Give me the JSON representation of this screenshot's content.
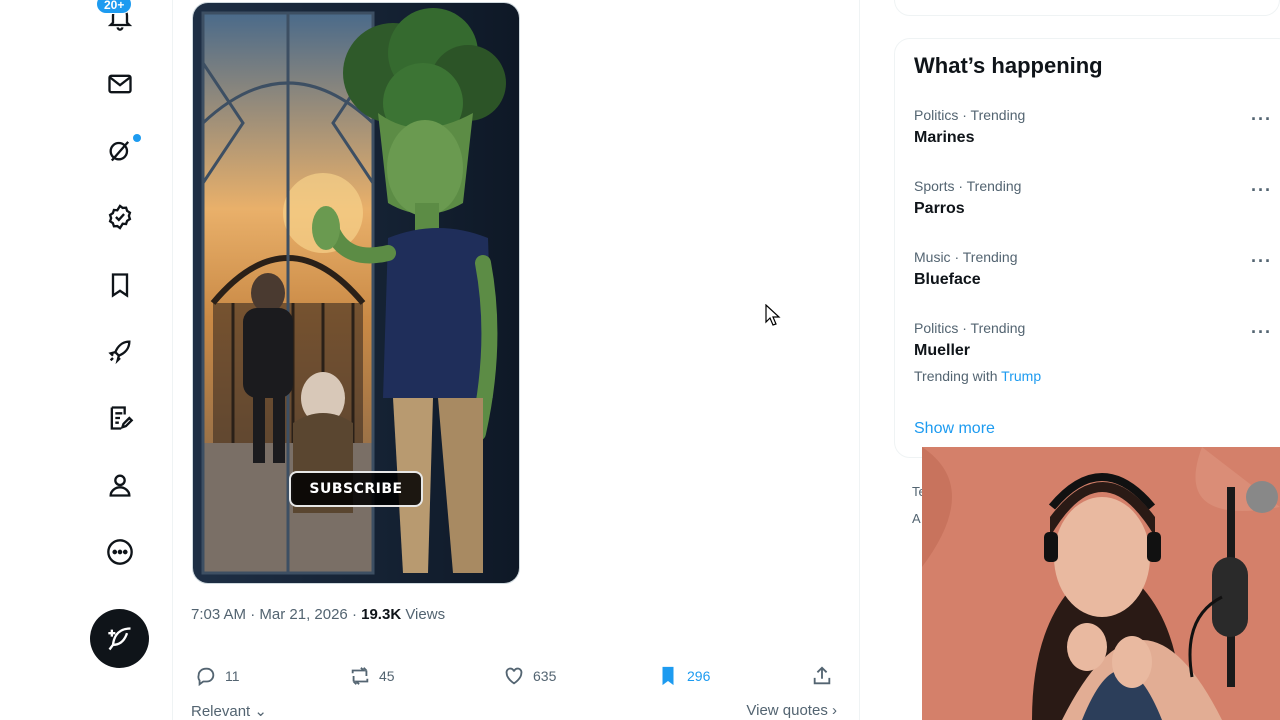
{
  "nav": {
    "notifications_badge": "20+",
    "icons": [
      "bell-icon",
      "mail-icon",
      "grok-icon",
      "verified-icon",
      "bookmark-icon",
      "rocket-icon",
      "notes-icon",
      "profile-icon",
      "more-icon"
    ],
    "compose_icon": "feather-plus-icon"
  },
  "post": {
    "media_overlay_label": "SUBSCRIBE",
    "time": "7:03 AM",
    "date": "Mar 21, 2026",
    "separator": "·",
    "views_count": "19.3K",
    "views_label": "Views",
    "actions": {
      "replies": "11",
      "reposts": "45",
      "likes": "635",
      "bookmarks": "296"
    },
    "sort_label": "Relevant",
    "view_quotes_label": "View quotes"
  },
  "trends": {
    "title": "What’s happening",
    "items": [
      {
        "context": "Politics · Trending",
        "name": "Marines"
      },
      {
        "context": "Sports · Trending",
        "name": "Parros"
      },
      {
        "context": "Music · Trending",
        "name": "Blueface"
      },
      {
        "context": "Politics · Trending",
        "name": "Mueller",
        "with_prefix": "Trending with",
        "with_link": "Trump"
      }
    ],
    "show_more": "Show more"
  },
  "footer_fragments": [
    "Te",
    "A"
  ],
  "colors": {
    "accent": "#1d9bf0",
    "text_primary": "#0f1419",
    "text_secondary": "#536471",
    "border": "#eff3f4",
    "compose_bg": "#0f1419"
  }
}
